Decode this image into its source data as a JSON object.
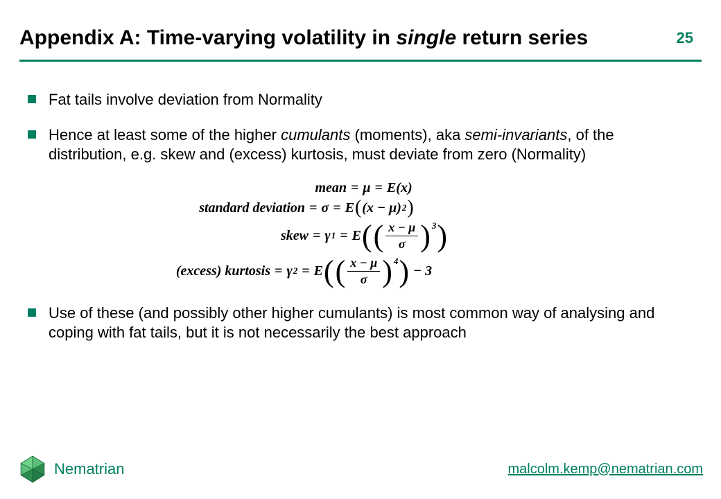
{
  "header": {
    "title_prefix": "Appendix A: Time-varying volatility in ",
    "title_italic": "single",
    "title_suffix": " return series",
    "page_number": "25"
  },
  "bullets": {
    "b1": "Fat tails involve deviation from Normality",
    "b2_pre": "Hence at least some of the higher ",
    "b2_i1": "cumulants",
    "b2_mid1": " (moments), aka ",
    "b2_i2": "semi-invariants",
    "b2_post": ", of the distribution, e.g. skew and (excess) kurtosis, must deviate from zero (Normality)",
    "b3": "Use of these (and possibly other higher cumulants) is most common way of analysing and coping with fat tails, but it is not necessarily the best approach"
  },
  "formulas": {
    "mean_label": "mean",
    "mu": "μ",
    "E": "E",
    "x": "x",
    "std_label": "standard deviation",
    "sigma": "σ",
    "two": "2",
    "skew_label": "skew",
    "gamma": "γ",
    "one": "1",
    "three": "3",
    "kurt_label": "(excess) kurtosis",
    "four": "4",
    "minus3": "− 3",
    "minus": "−",
    "eq": "="
  },
  "footer": {
    "brand": "Nematrian",
    "email": "malcolm.kemp@nematrian.com"
  }
}
